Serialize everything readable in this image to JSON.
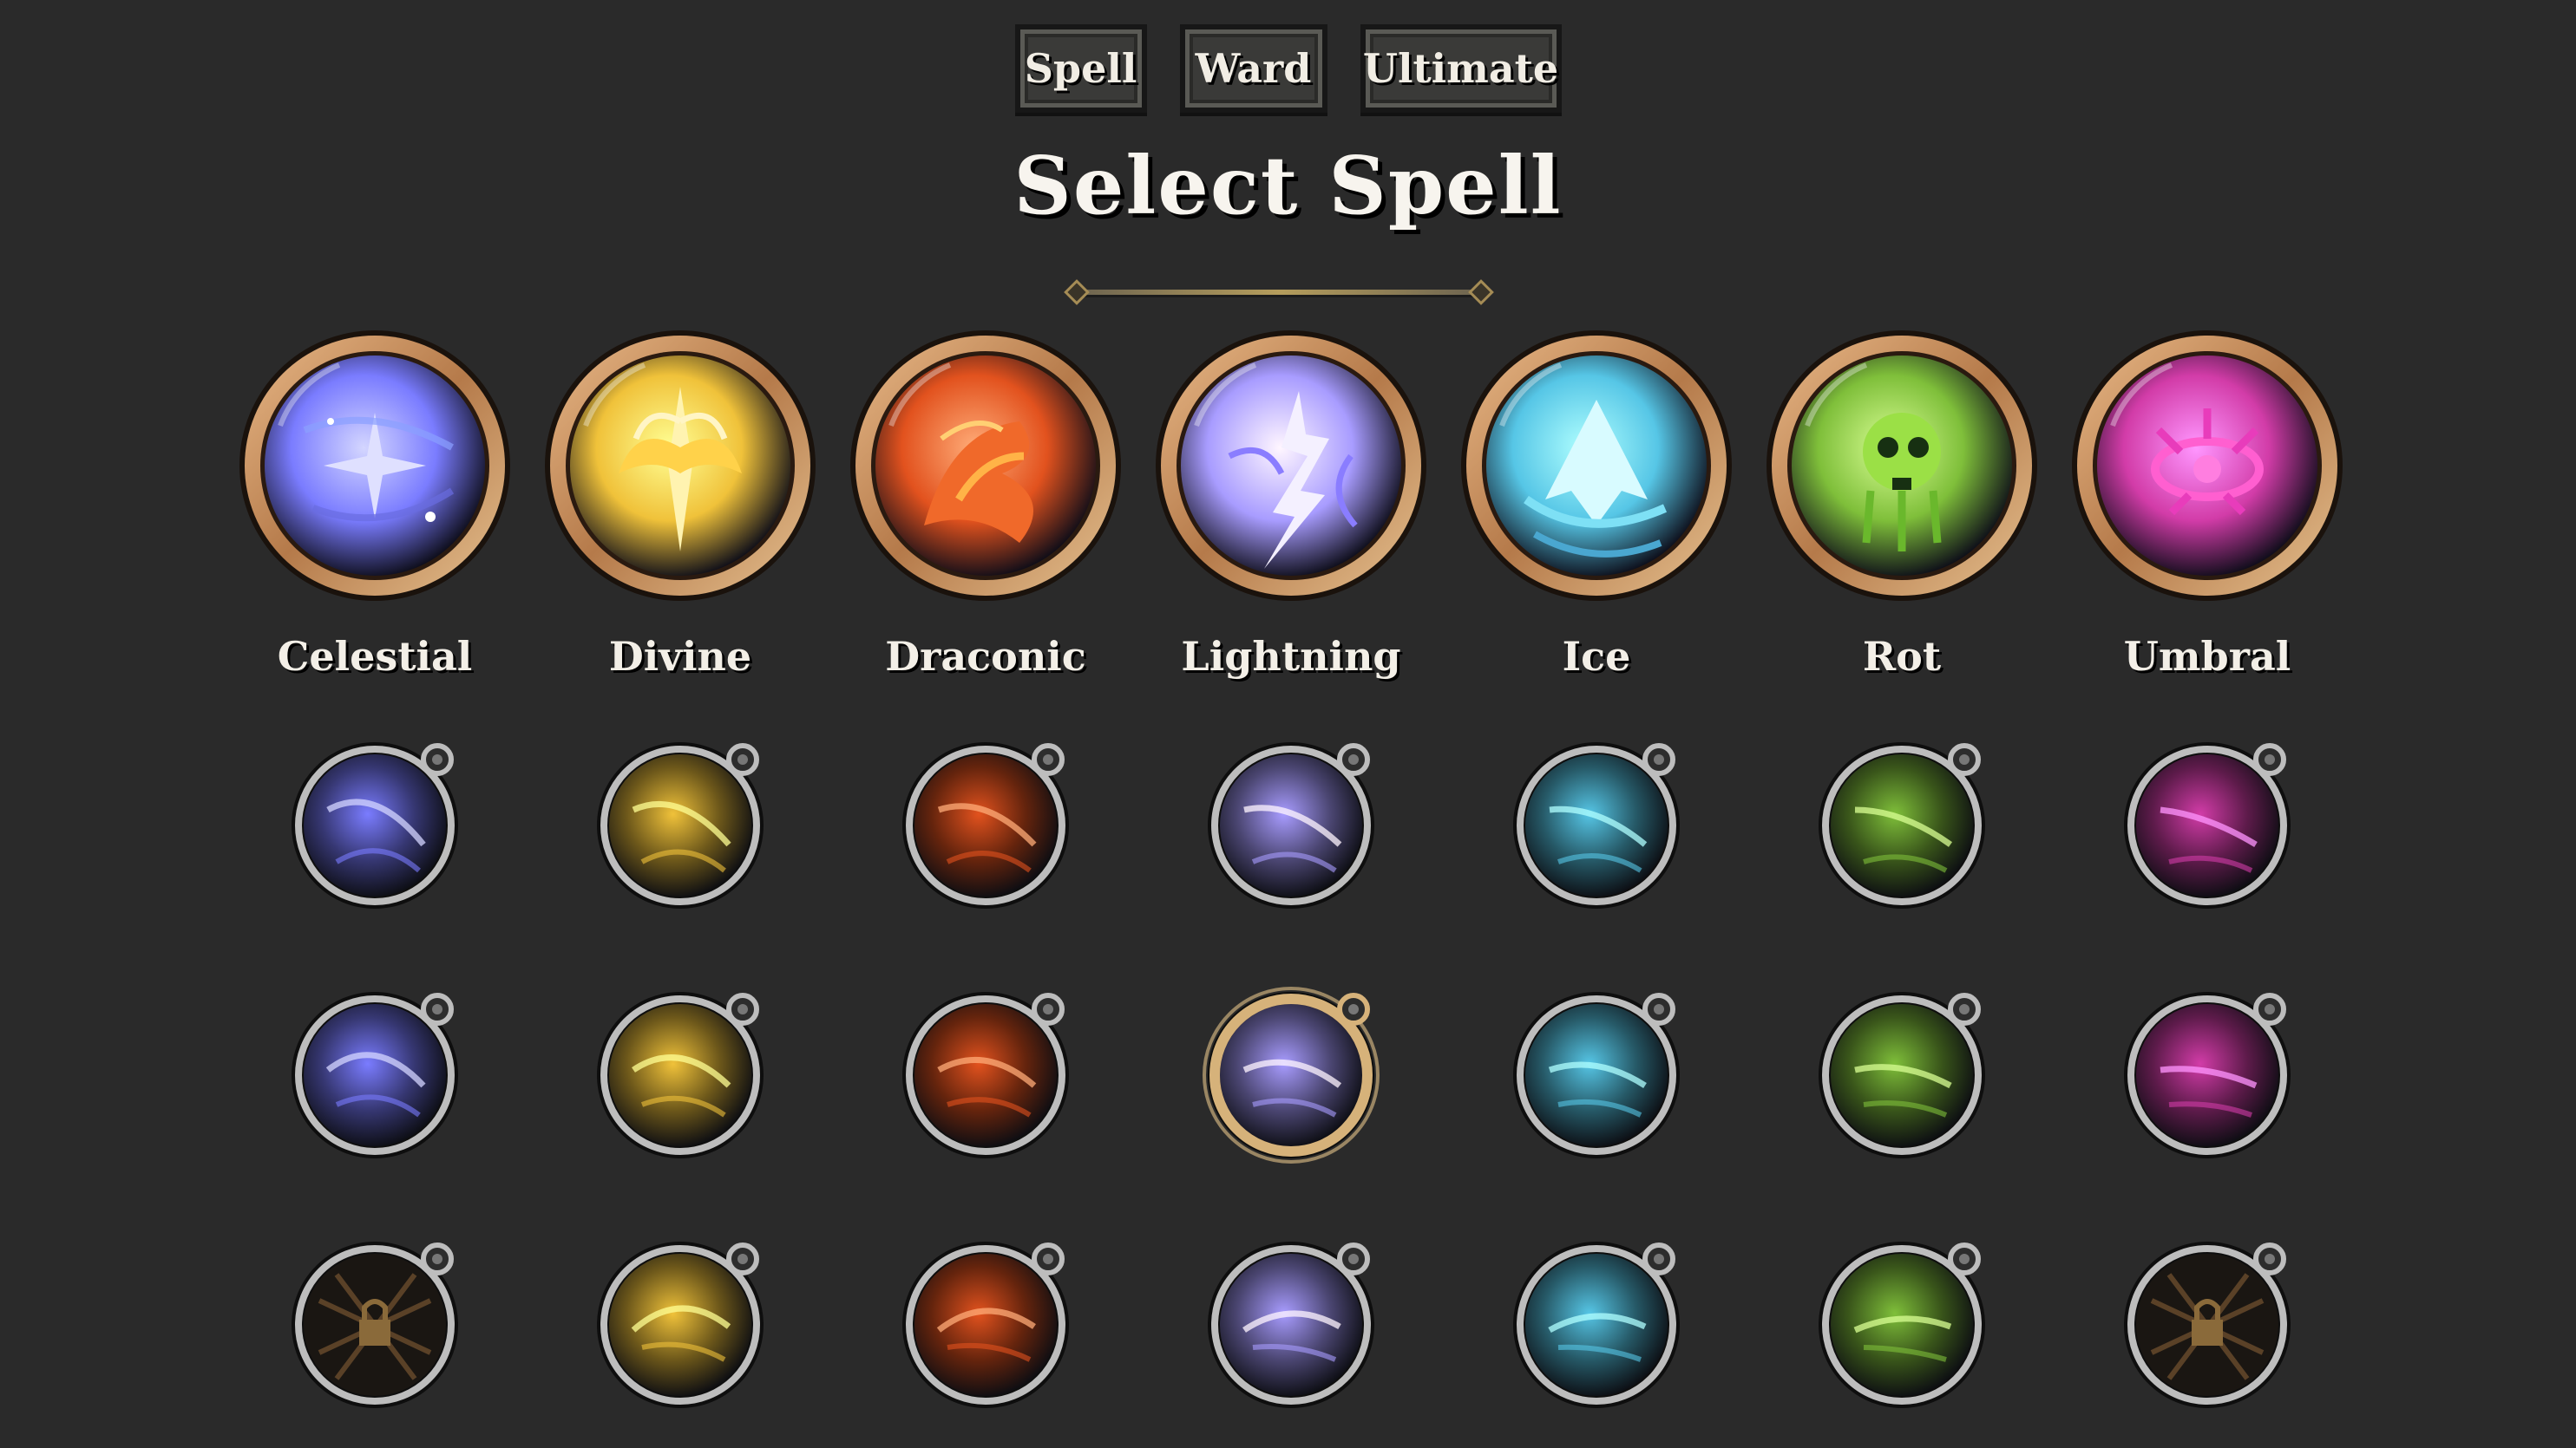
{
  "tabs": [
    {
      "label": "Spell",
      "active": true
    },
    {
      "label": "Ward",
      "active": false
    },
    {
      "label": "Ultimate",
      "active": false
    }
  ],
  "title": "Select Spell",
  "schools": [
    {
      "label": "Celestial",
      "icon": "celestial-star-icon",
      "color": "#7a7cff"
    },
    {
      "label": "Divine",
      "icon": "divine-winged-icon",
      "color": "#f0c23a"
    },
    {
      "label": "Draconic",
      "icon": "draconic-fire-icon",
      "color": "#e2521e"
    },
    {
      "label": "Lightning",
      "icon": "lightning-bolt-icon",
      "color": "#a89cff"
    },
    {
      "label": "Ice",
      "icon": "ice-peak-icon",
      "color": "#56c6e6"
    },
    {
      "label": "Rot",
      "icon": "rot-skull-icon",
      "color": "#7fbf3a"
    },
    {
      "label": "Umbral",
      "icon": "umbral-eye-icon",
      "color": "#d23ca8"
    }
  ],
  "spells": [
    [
      "celestial-streak-icon",
      "divine-rays-icon",
      "draconic-ember-icon",
      "lightning-arc-icon",
      "ice-shard-icon",
      "rot-skull-spell-icon",
      "umbral-claw-icon"
    ],
    [
      "celestial-crescent-icon",
      "divine-swirl-icon",
      "draconic-burst-icon",
      "lightning-storm-icon",
      "ice-crystal-icon",
      "rot-spores-icon",
      "umbral-slash-icon"
    ],
    [
      "locked-spell-icon",
      "divine-swirl-icon",
      "draconic-claws-icon",
      "lightning-strike-icon",
      "ice-wave-icon",
      "rot-blight-icon",
      "locked-spell-icon"
    ]
  ],
  "selected": {
    "row": 1,
    "column": 3
  }
}
